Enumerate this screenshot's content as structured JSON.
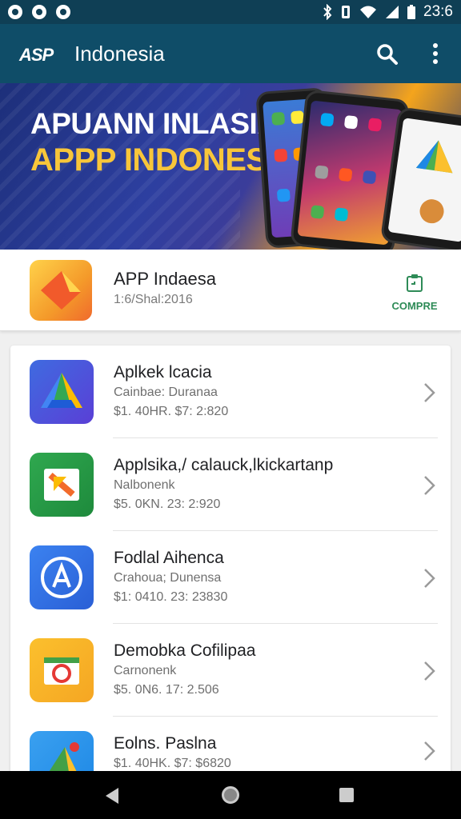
{
  "status_bar": {
    "time": "23:6"
  },
  "app_bar": {
    "logo": "ASP",
    "title": "Indonesia"
  },
  "banner": {
    "line1": "APUANN INLASIAI",
    "line2": "APPP INDONESIA"
  },
  "featured": {
    "name": "APP Indaesa",
    "meta": "1:6/Shal:2016",
    "action_label": "COMPRE"
  },
  "apps": [
    {
      "title": "Aplkek lcacia",
      "sub": "Cainbae: Duranaa",
      "price": "$1. 40HR. $7: 2:820",
      "icon": "drive-triangle-icon"
    },
    {
      "title": "Applsika,/ calauck,lkickartanp",
      "sub": "Nalbonenk",
      "price": "$5. 0KN. 23: 2:920",
      "icon": "green-square-icon"
    },
    {
      "title": "Fodlal Aihenca",
      "sub": "Crahoua; Dunensa",
      "price": "$1: 0410. 23: 23830",
      "icon": "app-store-a-icon"
    },
    {
      "title": "Demobka Cofilipaa",
      "sub": "Carnonenk",
      "price": "$5. 0N6. 17: 2.506",
      "icon": "photo-camera-icon"
    },
    {
      "title": "Eolns. Paslna",
      "sub": "",
      "price": "$1. 40HK. $7: $6820",
      "icon": "maps-pin-icon"
    }
  ]
}
